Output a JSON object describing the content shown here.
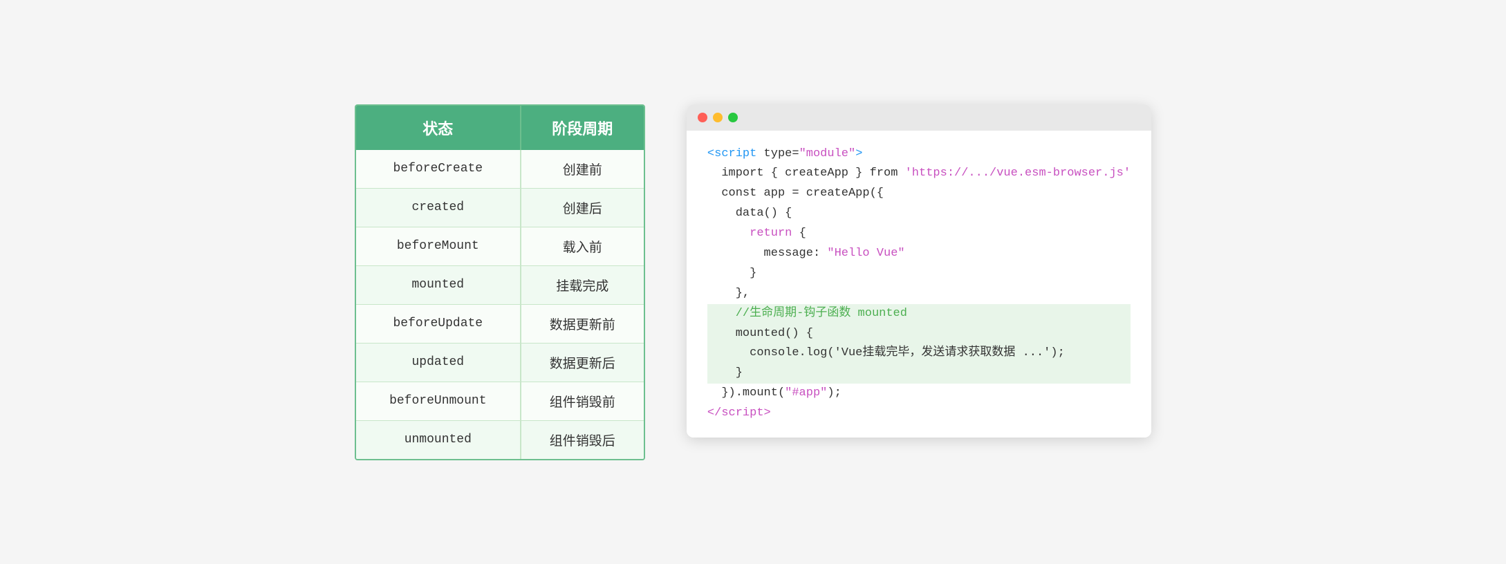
{
  "table": {
    "header": [
      "状态",
      "阶段周期"
    ],
    "rows": [
      [
        "beforeCreate",
        "创建前"
      ],
      [
        "created",
        "创建后"
      ],
      [
        "beforeMount",
        "载入前"
      ],
      [
        "mounted",
        "挂载完成"
      ],
      [
        "beforeUpdate",
        "数据更新前"
      ],
      [
        "updated",
        "数据更新后"
      ],
      [
        "beforeUnmount",
        "组件销毁前"
      ],
      [
        "unmounted",
        "组件销毁后"
      ]
    ]
  },
  "window": {
    "dots": [
      "red",
      "yellow",
      "green"
    ]
  },
  "code": {
    "lines": [
      {
        "text": "<script type=\"module\">",
        "class": "c-tag",
        "highlighted": false
      },
      {
        "text": "  import { createApp } from 'https://.../vue.esm-browser.js'",
        "highlighted": false
      },
      {
        "text": "  const app = createApp({",
        "highlighted": false
      },
      {
        "text": "    data() {",
        "highlighted": false
      },
      {
        "text": "      return {",
        "highlighted": false
      },
      {
        "text": "        message: \"Hello Vue\"",
        "highlighted": false
      },
      {
        "text": "      }",
        "highlighted": false
      },
      {
        "text": "    },",
        "highlighted": false
      },
      {
        "text": "    //生命周期-钩子函数 mounted",
        "highlighted": true,
        "comment": true
      },
      {
        "text": "    mounted() {",
        "highlighted": true
      },
      {
        "text": "      console.log('Vue挂载完毕，发送请求获取数据 ...');",
        "highlighted": true
      },
      {
        "text": "    }",
        "highlighted": true
      },
      {
        "text": "  }).mount(\"#app\");",
        "highlighted": false
      },
      {
        "text": "</script>",
        "highlighted": false,
        "closing": true
      }
    ]
  }
}
